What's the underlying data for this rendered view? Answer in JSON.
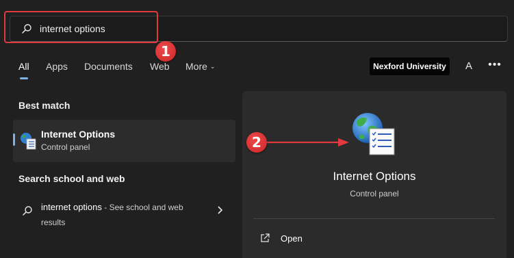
{
  "search": {
    "query": "internet options"
  },
  "annotations": {
    "badge_1": "1",
    "badge_2": "2"
  },
  "tabs": [
    {
      "label": "All",
      "active": true
    },
    {
      "label": "Apps"
    },
    {
      "label": "Documents"
    },
    {
      "label": "Web"
    },
    {
      "label": "More"
    }
  ],
  "header": {
    "org_name": "Nexford University",
    "avatar_letter": "A",
    "more_icon": "more-horizontal-icon"
  },
  "best_match": {
    "section_title": "Best match",
    "item": {
      "title": "Internet Options",
      "subtitle": "Control panel",
      "icon": "internet-options-icon"
    }
  },
  "web_search": {
    "section_title": "Search school and web",
    "item": {
      "query": "internet options",
      "suffix": " - See school and web results"
    }
  },
  "detail": {
    "title": "Internet Options",
    "subtitle": "Control panel",
    "actions": [
      {
        "label": "Open",
        "icon": "open-external-icon"
      }
    ]
  },
  "colors": {
    "accent": "#7fb0e8",
    "annotation_red": "#e0393e",
    "background": "#202020"
  }
}
